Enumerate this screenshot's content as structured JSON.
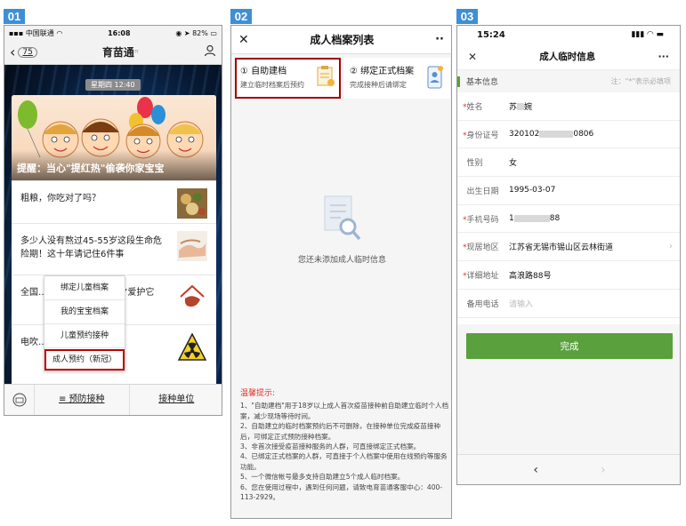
{
  "steps": [
    "01",
    "02",
    "03"
  ],
  "phone1": {
    "status": {
      "carrier": "中国联通",
      "time": "16:08",
      "battery": "82%"
    },
    "nav": {
      "back_symbol": "‹",
      "unread": "75",
      "title": "育苗通",
      "ear": "◯"
    },
    "chat": {
      "timestamp": "星期四 12:40",
      "banner_title": "提醒：当心\"提红热\"偷袭你家宝宝",
      "articles": [
        {
          "title": "粗粮，你吃对了吗？"
        },
        {
          "title": "多少人没有熬过45-55岁这段生命危险期！这十年请记住6件事"
        },
        {
          "title": "全国…“最沉默的小伙…意”爱护它"
        },
        {
          "title": "电吹…子不能用？"
        }
      ]
    },
    "popup_menu": {
      "items": [
        "绑定儿童档案",
        "我的宝宝档案",
        "儿童预约接种"
      ],
      "highlight": "成人预约（新冠）"
    },
    "bottom_menu": {
      "tab1": "预防接种",
      "tab2": "接种单位"
    }
  },
  "phone2": {
    "nav": {
      "close": "✕",
      "title": "成人档案列表",
      "more": "··"
    },
    "tabs": [
      {
        "title": "① 自助建档",
        "subtitle": "建立临时档案后预约"
      },
      {
        "title": "② 绑定正式档案",
        "subtitle": "完成接种后请绑定"
      }
    ],
    "empty_text": "您还未添加成人临时信息",
    "tips": {
      "heading": "温馨提示:",
      "lines": [
        "1、\"自助建档\"用于18岁以上成人首次疫苗接种前自助建立临时个人档案，减少现场等待时间。",
        "2、自助建立的临时档案预约后不可删除，在接种单位完成疫苗接种后，可绑定正式预防接种档案。",
        "3、非首次接受疫苗接种服务的人群，可直接绑定正式档案。",
        "4、已绑定正式档案的人群，可直接于个人档案中使用在线预约等服务功能。",
        "5、一个微信帐号最多支持自助建立5个成人临时档案。",
        "6、您在使用过程中，遇到任何问题，请致电育苗通客服中心：400-113-2929。"
      ]
    }
  },
  "phone3": {
    "status": {
      "time": "15:24"
    },
    "nav": {
      "close": "✕",
      "title": "成人临时信息",
      "more": "···"
    },
    "section": {
      "label": "基本信息",
      "note": "注：\"*\"表示必填项"
    },
    "fields": [
      {
        "label": "姓名",
        "required": true,
        "value_prefix": "苏",
        "value_suffix": "婉"
      },
      {
        "label": "身份证号",
        "required": true,
        "value_prefix": "320102",
        "value_suffix": "0806"
      },
      {
        "label": "性别",
        "required": false,
        "value": "女"
      },
      {
        "label": "出生日期",
        "required": false,
        "value": "1995-03-07"
      },
      {
        "label": "手机号码",
        "required": true,
        "value_prefix": "1",
        "value_suffix": "88"
      },
      {
        "label": "现居地区",
        "required": true,
        "value": "江苏省无锡市锡山区云林街道"
      },
      {
        "label": "详细地址",
        "required": true,
        "value": "高浪路88号"
      },
      {
        "label": "备用电话",
        "required": false,
        "placeholder": "请输入"
      }
    ],
    "submit_label": "完成",
    "browser": {
      "back": "‹",
      "forward": "›"
    },
    "colors": {
      "accent": "#5aa03c",
      "required": "#e0322a"
    }
  }
}
